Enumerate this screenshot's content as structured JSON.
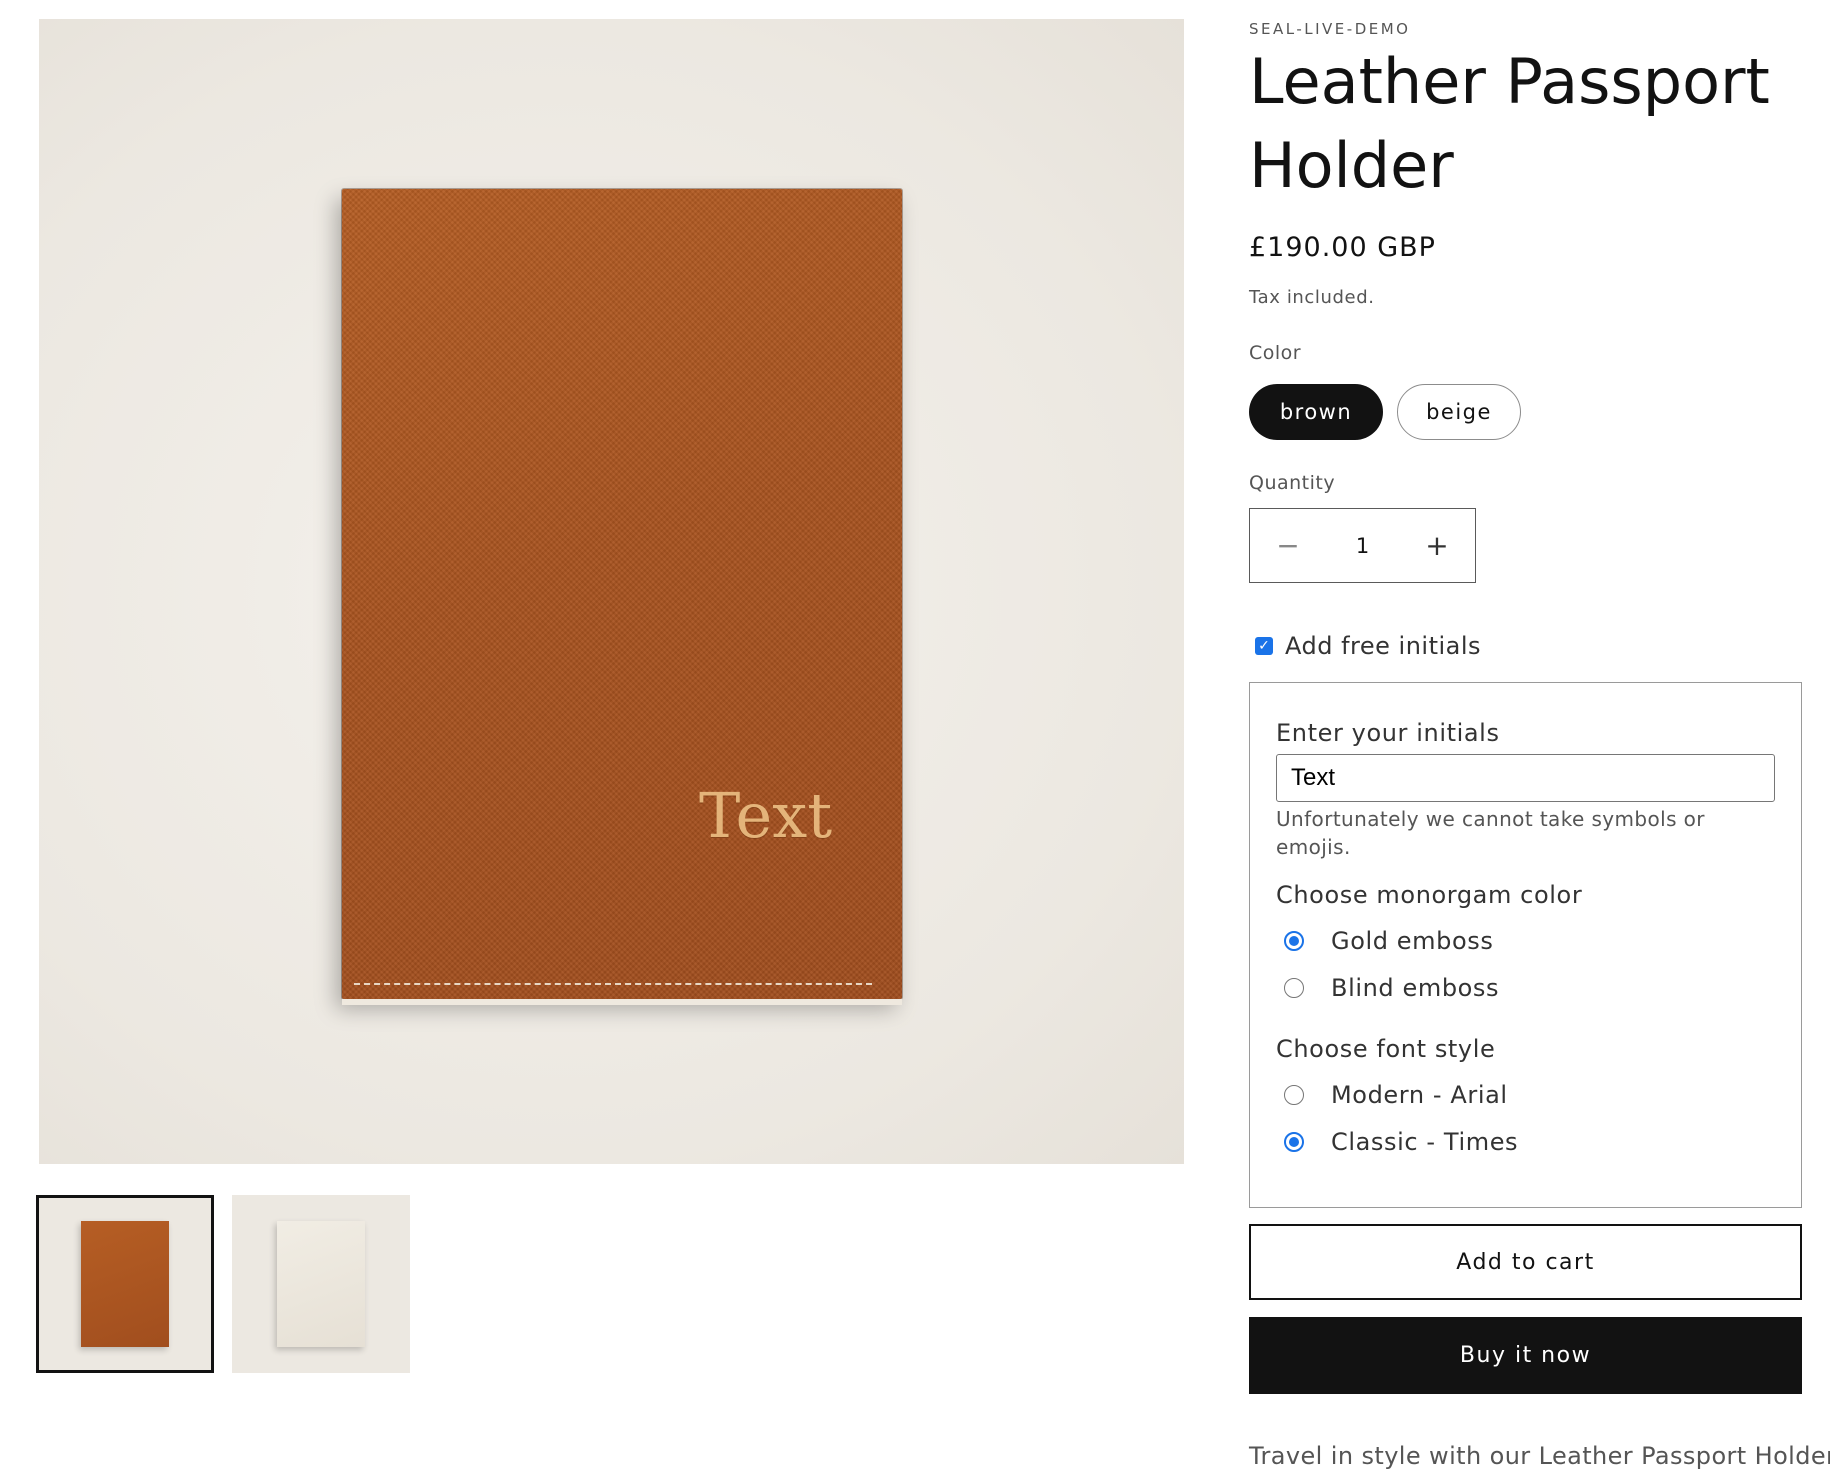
{
  "gallery": {
    "monogram_preview": "Text",
    "thumbnails": [
      {
        "color": "brown",
        "selected": true
      },
      {
        "color": "beige",
        "selected": false
      }
    ]
  },
  "product": {
    "vendor": "SEAL-LIVE-DEMO",
    "title": "Leather Passport Holder",
    "price": "£190.00 GBP",
    "tax_note": "Tax included.",
    "color_label": "Color",
    "colors": [
      {
        "label": "brown",
        "selected": true
      },
      {
        "label": "beige",
        "selected": false
      }
    ],
    "quantity_label": "Quantity",
    "quantity": "1",
    "quantity_minus": "−",
    "quantity_plus": "+",
    "description": "Travel in style with our Leather Passport Holder."
  },
  "personalization": {
    "checkbox_label": "Add free initials",
    "checked": true,
    "initials_label": "Enter your initials",
    "initials_value": "Text",
    "hint": "Unfortunately we cannot take symbols or emojis.",
    "monogram_color_label": "Choose monorgam color",
    "monogram_options": [
      {
        "label": "Gold emboss",
        "selected": true
      },
      {
        "label": "Blind emboss",
        "selected": false
      }
    ],
    "font_style_label": "Choose font style",
    "font_options": [
      {
        "label": "Modern - Arial",
        "selected": false
      },
      {
        "label": "Classic - Times",
        "selected": true
      }
    ]
  },
  "actions": {
    "add_to_cart": "Add to cart",
    "buy_now": "Buy it now"
  },
  "colors": {
    "accent": "#1a73e8",
    "primary_dark": "#121212",
    "leather_brown": "#a95420",
    "monogram_gold": "#e4b47a"
  }
}
